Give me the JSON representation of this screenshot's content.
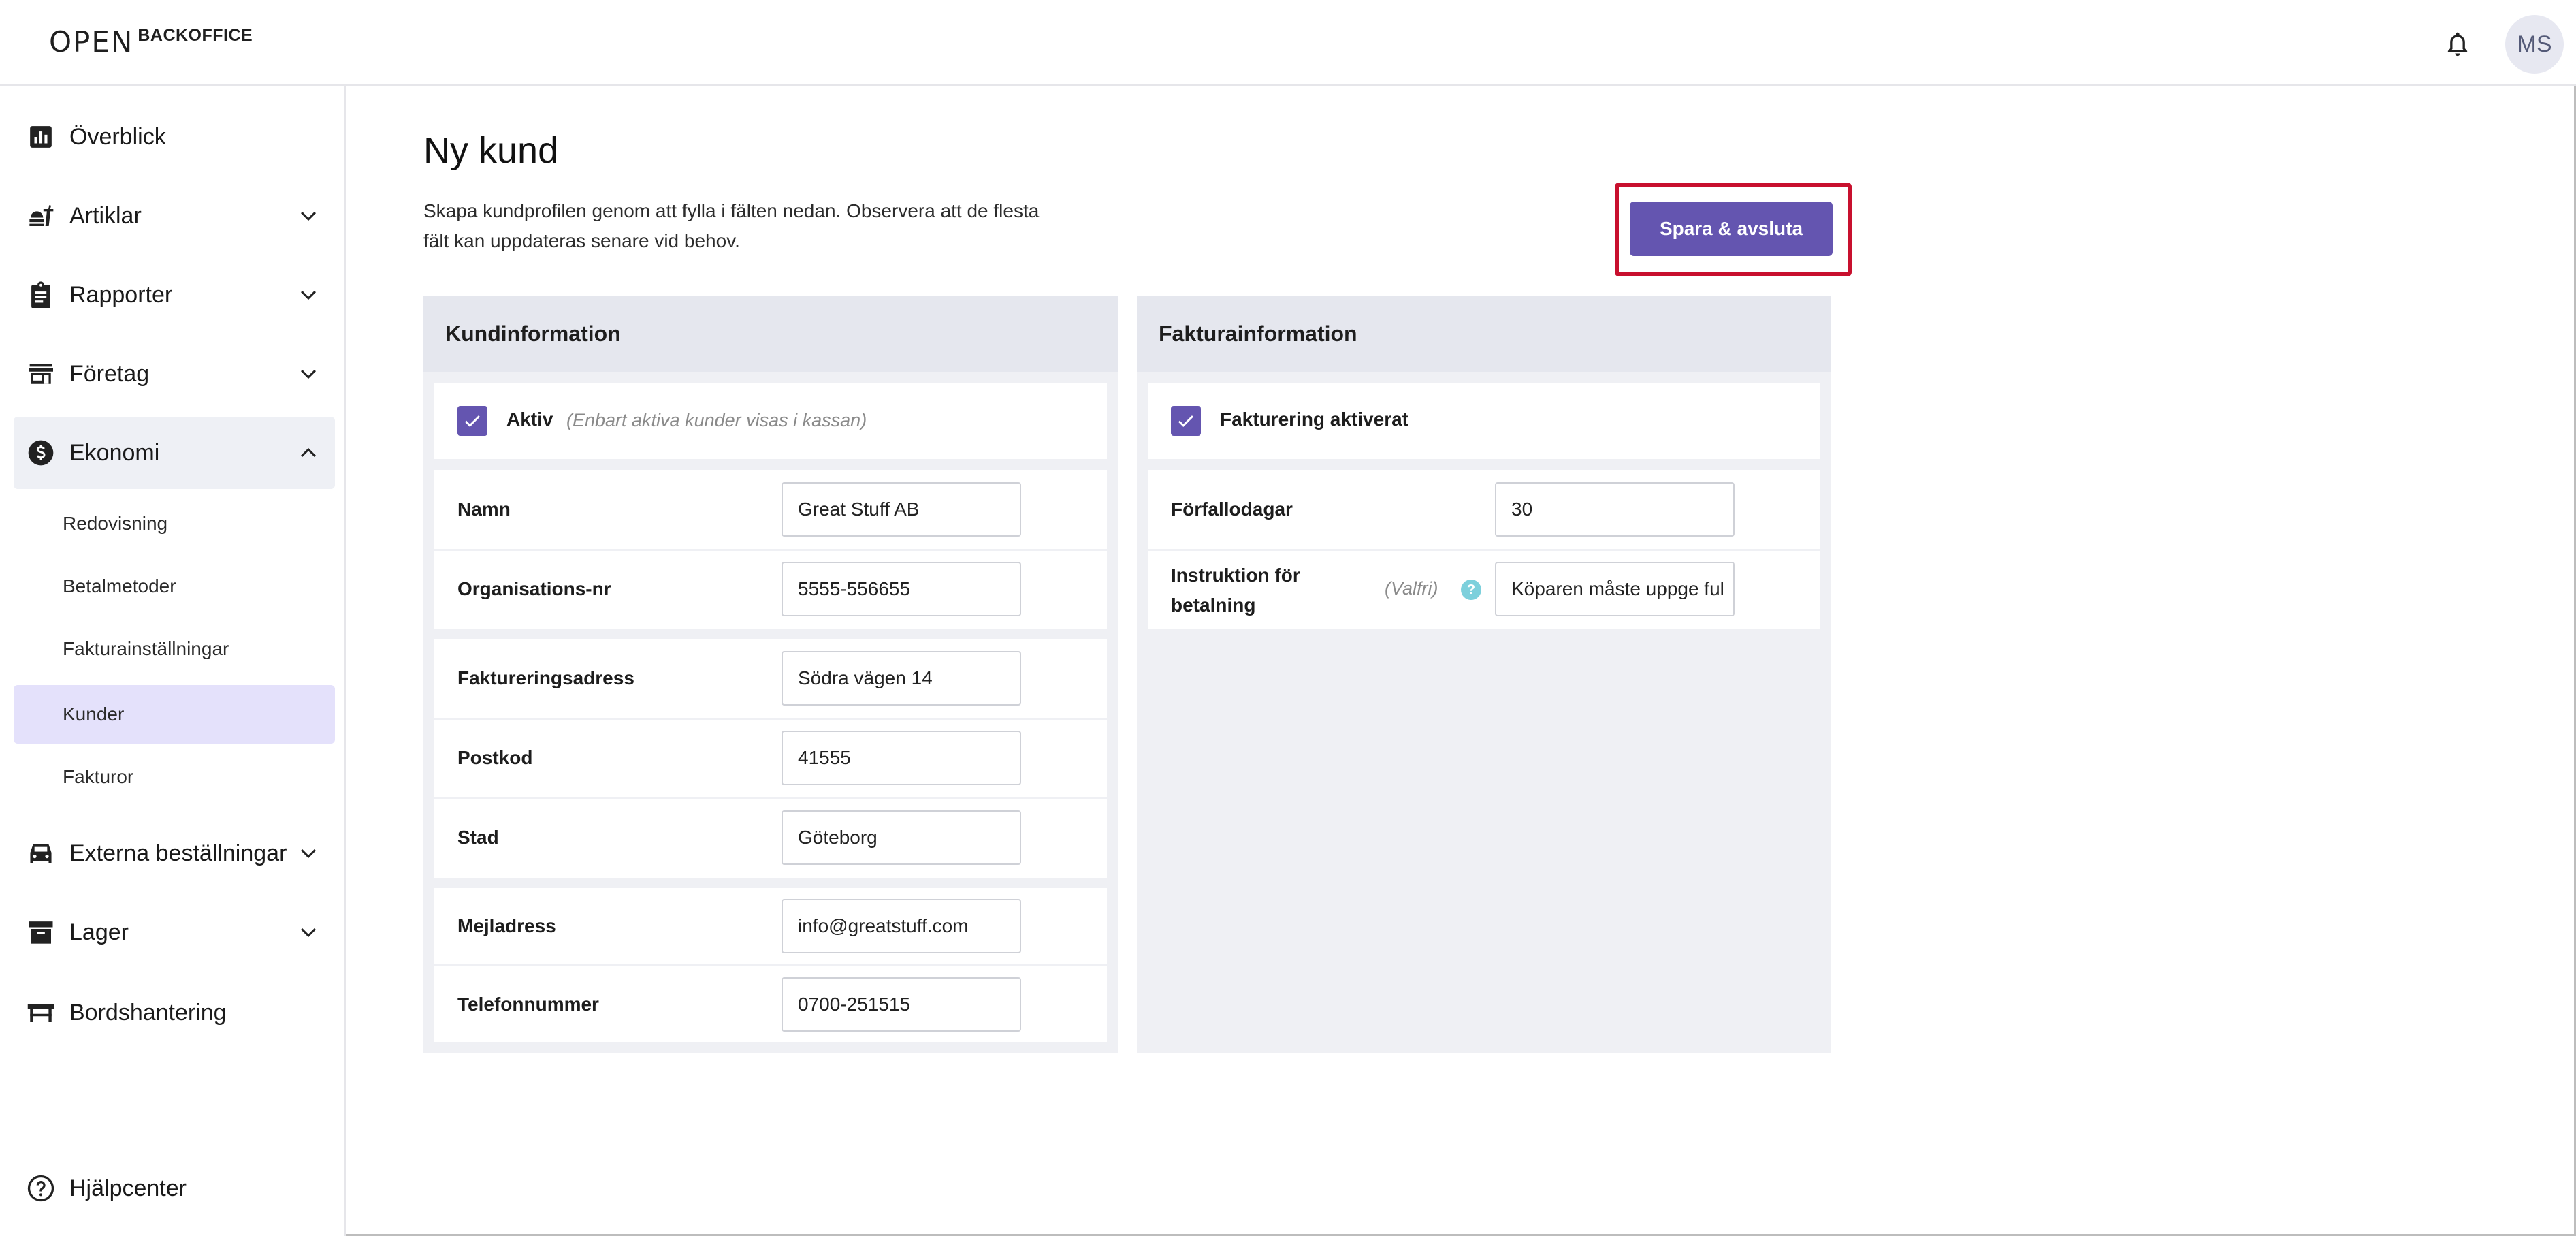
{
  "header": {
    "logo_mark": "OPEN",
    "logo_text": "BACKOFFICE",
    "avatar_initials": "MS"
  },
  "sidebar": {
    "items": [
      {
        "label": "Överblick",
        "icon": "chart-icon"
      },
      {
        "label": "Artiklar",
        "icon": "food-icon"
      },
      {
        "label": "Rapporter",
        "icon": "clipboard-icon"
      },
      {
        "label": "Företag",
        "icon": "store-icon"
      },
      {
        "label": "Ekonomi",
        "icon": "dollar-icon"
      },
      {
        "label": "Externa beställningar",
        "icon": "car-icon"
      },
      {
        "label": "Lager",
        "icon": "archive-icon"
      },
      {
        "label": "Bordshantering",
        "icon": "table-icon"
      }
    ],
    "ekonomi_sub": [
      {
        "label": "Redovisning"
      },
      {
        "label": "Betalmetoder"
      },
      {
        "label": "Fakturainställningar"
      },
      {
        "label": "Kunder"
      },
      {
        "label": "Fakturor"
      }
    ],
    "help_label": "Hjälpcenter"
  },
  "main": {
    "title": "Ny kund",
    "description": "Skapa kundprofilen genom att fylla i fälten nedan. Observera att de flesta fält kan uppdateras senare vid behov.",
    "save_label": "Spara & avsluta"
  },
  "customer_panel": {
    "title": "Kundinformation",
    "active_label": "Aktiv",
    "active_hint": "(Enbart aktiva kunder visas i kassan)",
    "fields": [
      {
        "label": "Namn",
        "value": "Great Stuff AB"
      },
      {
        "label": "Organisations-nr",
        "value": "5555-556655"
      },
      {
        "label": "Faktureringsadress",
        "value": "Södra vägen 14"
      },
      {
        "label": "Postkod",
        "value": "41555"
      },
      {
        "label": "Stad",
        "value": "Göteborg"
      },
      {
        "label": "Mejladress",
        "value": "info@greatstuff.com"
      },
      {
        "label": "Telefonnummer",
        "value": "0700-251515"
      }
    ]
  },
  "invoice_panel": {
    "title": "Fakturainformation",
    "enabled_label": "Fakturering aktiverat",
    "due_days_label": "Förfallodagar",
    "due_days_value": "30",
    "instruction_label": "Instruktion för betalning",
    "instruction_optional": "(Valfri)",
    "instruction_value": "Köparen måste uppge ful"
  },
  "colors": {
    "accent": "#6455b0",
    "highlight": "#c8102e",
    "active_sub_bg": "#e4e1fb"
  }
}
